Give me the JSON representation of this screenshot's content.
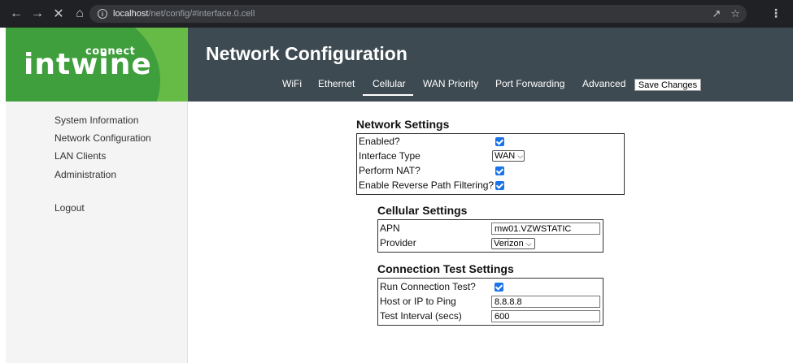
{
  "browser": {
    "url_host": "localhost",
    "url_path": "/net/config/#interface.0.cell"
  },
  "logo": {
    "text": "intwine",
    "sub": "connect"
  },
  "header": {
    "title": "Network Configuration",
    "tabs": [
      "WiFi",
      "Ethernet",
      "Cellular",
      "WAN Priority",
      "Port Forwarding",
      "Advanced"
    ],
    "active_tab": "Cellular",
    "save_label": "Save Changes"
  },
  "sidebar": {
    "items": [
      "System Information",
      "Network Configuration",
      "LAN Clients",
      "Administration",
      "Logout"
    ]
  },
  "network_settings": {
    "title": "Network Settings",
    "enabled_label": "Enabled?",
    "interface_type_label": "Interface Type",
    "interface_type_value": "WAN",
    "nat_label": "Perform NAT?",
    "rpf_label": "Enable Reverse Path Filtering?"
  },
  "cellular_settings": {
    "title": "Cellular Settings",
    "apn_label": "APN",
    "apn_value": "mw01.VZWSTATIC",
    "provider_label": "Provider",
    "provider_value": "Verizon"
  },
  "connection_test": {
    "title": "Connection Test Settings",
    "run_label": "Run Connection Test?",
    "host_label": "Host or IP to Ping",
    "host_value": "8.8.8.8",
    "interval_label": "Test Interval (secs)",
    "interval_value": "600"
  },
  "colors": {
    "header_bg": "#3d4a52",
    "logo_green": "#66bb46",
    "checkbox_blue": "#1a73e8"
  }
}
